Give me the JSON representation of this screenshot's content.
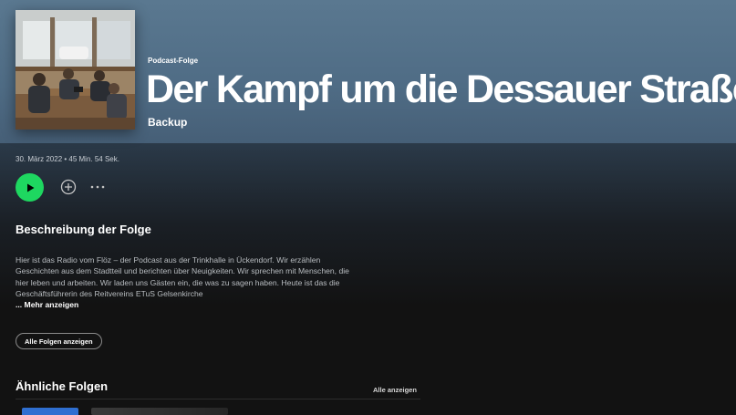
{
  "header": {
    "type_label": "Podcast-Folge",
    "title": "Der Kampf um die Dessauer Straße",
    "show_name": "Backup"
  },
  "episode": {
    "meta": "30. März 2022 • 45 Min. 54 Sek."
  },
  "description": {
    "heading": "Beschreibung der Folge",
    "text": "Hier ist das Radio vom Flöz – der Podcast aus der Trinkhalle in Ückendorf. Wir erzählen Geschichten aus dem Stadtteil und berichten über Neuigkeiten. Wir sprechen mit Menschen, die hier leben und arbeiten. Wir laden uns Gästen ein, die was zu sagen haben. Heute ist das die Geschäftsführerin des Reitvereins ETuS Gelsenkirche",
    "show_more": "... Mehr anzeigen",
    "all_episodes": "Alle Folgen anzeigen"
  },
  "similar": {
    "heading": "Ähnliche Folgen",
    "show_all": "Alle anzeigen"
  },
  "icons": {
    "play": "play-icon",
    "add": "plus-circle-icon",
    "more": "more-horizontal-icon"
  },
  "colors": {
    "accent": "#1ed760",
    "hero": "#5a7890",
    "background": "#121212"
  }
}
